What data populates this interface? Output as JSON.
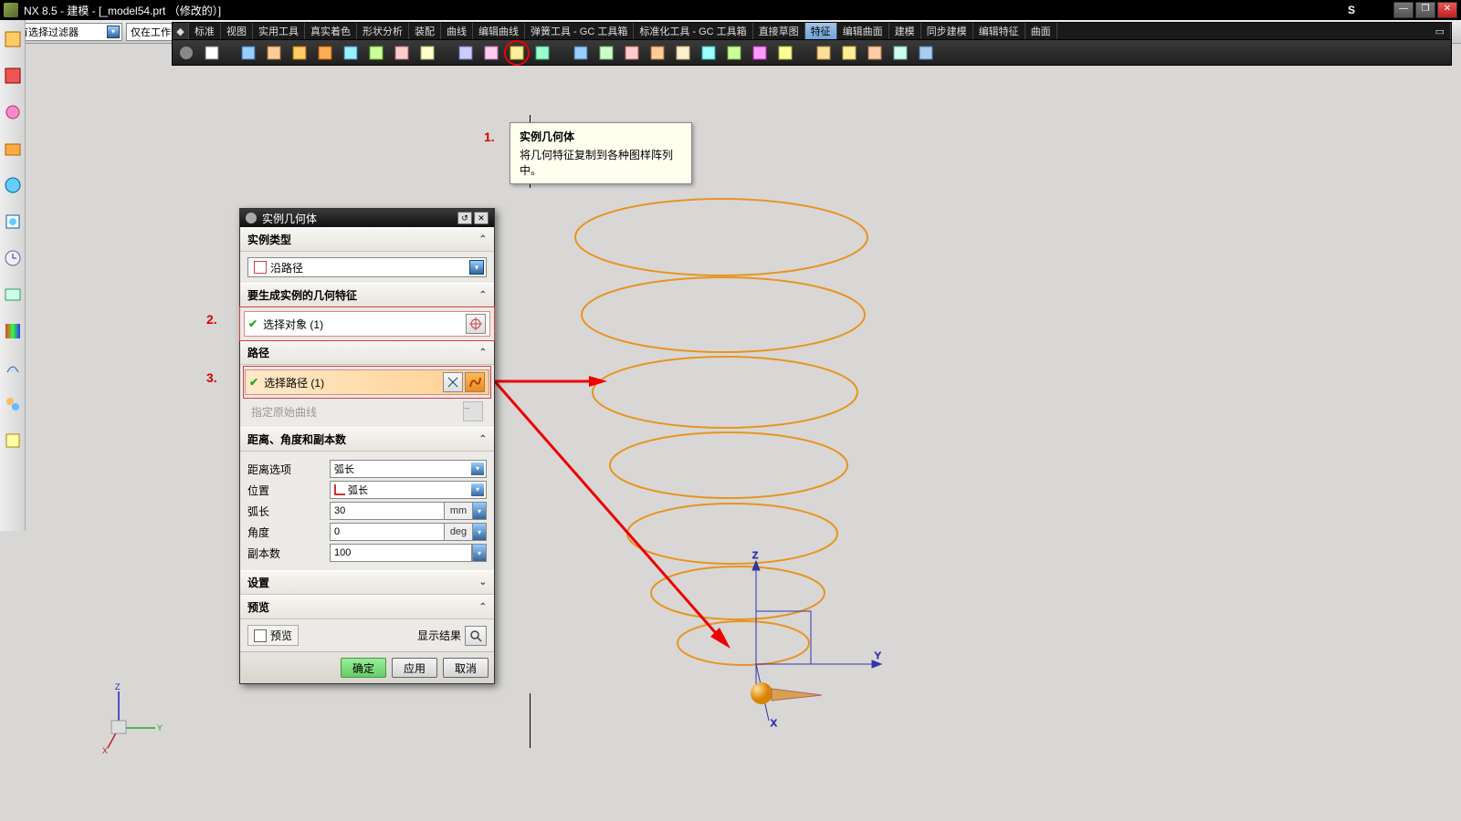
{
  "app": {
    "title": "NX 8.5 - 建模 - [_model54.prt （修改的）]",
    "s": "S"
  },
  "filter": {
    "combo1": "没有选择过滤器",
    "combo2": "仅在工作部件内"
  },
  "ribbon": {
    "tabs": [
      "标准",
      "视图",
      "实用工具",
      "真实着色",
      "形状分析",
      "装配",
      "曲线",
      "编辑曲线",
      "弹簧工具 - GC 工具箱",
      "标准化工具 - GC 工具箱",
      "直接草图",
      "特征",
      "编辑曲面",
      "建模",
      "同步建模",
      "编辑特征",
      "曲面"
    ],
    "active_index": 11
  },
  "tooltip": {
    "title": "实例几何体",
    "desc": "将几何特征复制到各种图样阵列中。"
  },
  "callouts": {
    "c1": "1.",
    "c2": "2.",
    "c3": "3."
  },
  "dialog": {
    "title": "实例几何体",
    "sections": {
      "type": {
        "header": "实例类型",
        "combo": "沿路径"
      },
      "features": {
        "header": "要生成实例的几何特征",
        "select": "选择对象 (1)"
      },
      "path": {
        "header": "路径",
        "select": "选择路径 (1)",
        "disabled": "指定原始曲线"
      },
      "params": {
        "header": "距离、角度和副本数",
        "dist_option_label": "距离选项",
        "dist_option": "弧长",
        "position_label": "位置",
        "position": "弧长",
        "arc_label": "弧长",
        "arc_value": "30",
        "arc_unit": "mm",
        "angle_label": "角度",
        "angle_value": "0",
        "angle_unit": "deg",
        "copies_label": "副本数",
        "copies_value": "100"
      },
      "settings": {
        "header": "设置"
      },
      "preview": {
        "header": "预览",
        "checkbox": "预览",
        "result": "显示结果"
      }
    },
    "buttons": {
      "ok": "确定",
      "apply": "应用",
      "cancel": "取消"
    }
  },
  "axes": {
    "x": "X",
    "y": "Y",
    "z": "Z"
  }
}
